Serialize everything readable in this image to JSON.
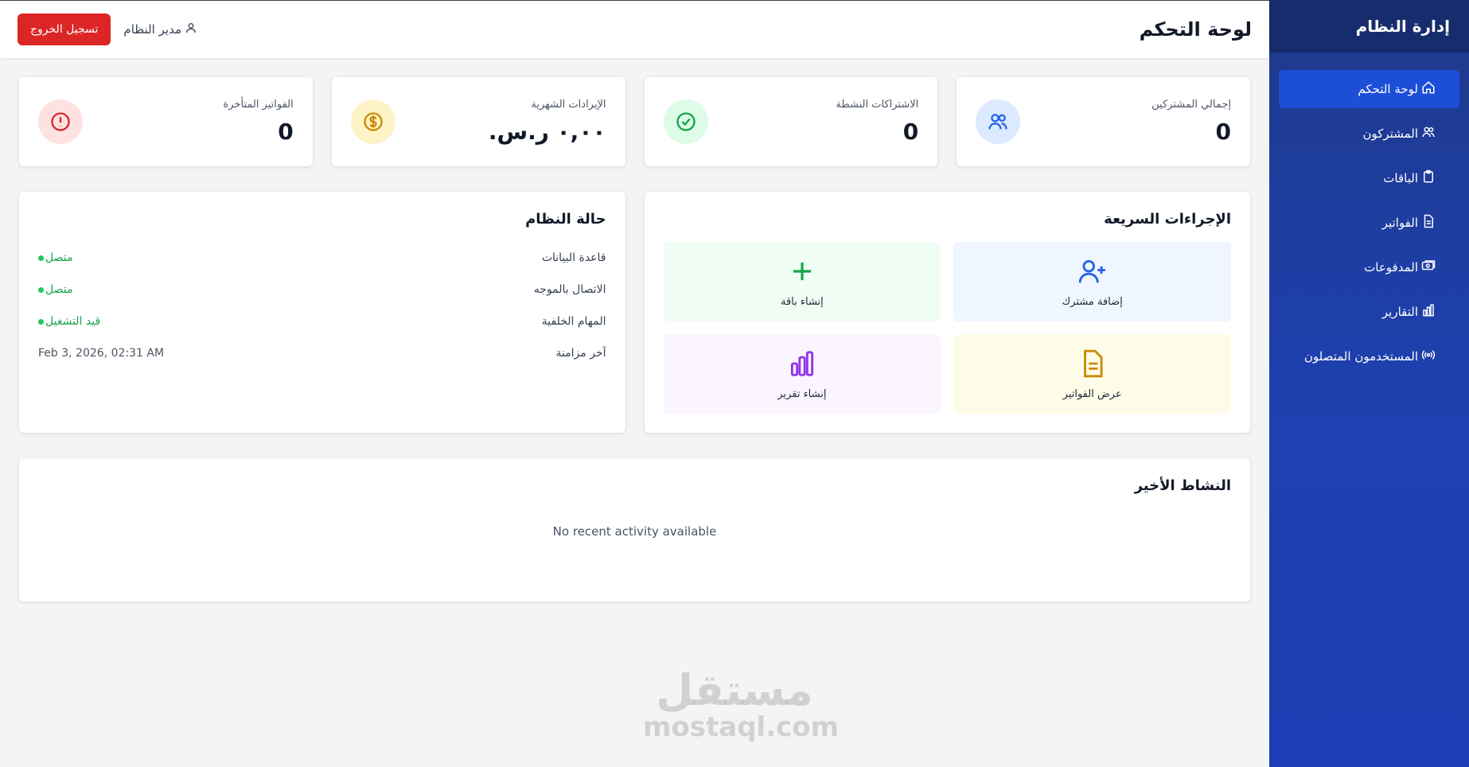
{
  "sidebar": {
    "title": "إدارة النظام",
    "items": [
      {
        "label": "لوحة التحكم",
        "icon": "home-icon",
        "active": true
      },
      {
        "label": "المشتركون",
        "icon": "users-icon"
      },
      {
        "label": "الباقات",
        "icon": "clipboard-icon"
      },
      {
        "label": "الفواتير",
        "icon": "document-icon"
      },
      {
        "label": "المدفوعات",
        "icon": "cash-icon"
      },
      {
        "label": "التقارير",
        "icon": "chart-icon"
      },
      {
        "label": "المستخدمون المتصلون",
        "icon": "broadcast-icon"
      }
    ]
  },
  "header": {
    "title": "لوحة التحكم",
    "user": "مدير النظام",
    "logout": "تسجيل الخروج"
  },
  "stats": [
    {
      "label": "إجمالي المشتركين",
      "value": "0",
      "icon": "users-icon",
      "color": "#2563eb",
      "bg": "#dbeafe"
    },
    {
      "label": "الاشتراكات النشطة",
      "value": "0",
      "icon": "check-circle-icon",
      "color": "#16a34a",
      "bg": "#dcfce7"
    },
    {
      "label": "الإيرادات الشهرية",
      "value": "٠,٠٠ ر.س.",
      "icon": "dollar-icon",
      "color": "#ca8a04",
      "bg": "#fef3c7"
    },
    {
      "label": "الفواتير المتأخرة",
      "value": "0",
      "icon": "alert-icon",
      "color": "#dc2626",
      "bg": "#fee2e2"
    }
  ],
  "quick_actions": {
    "title": "الإجراءات السريعة",
    "items": [
      {
        "label": "إضافة مشترك",
        "icon": "user-plus-icon",
        "color": "#2563eb",
        "bg": "#eff6ff"
      },
      {
        "label": "إنشاء باقة",
        "icon": "plus-icon",
        "color": "#16a34a",
        "bg": "#f0fdf4"
      },
      {
        "label": "عرض الفواتير",
        "icon": "document-icon",
        "color": "#ca8a04",
        "bg": "#fefce8"
      },
      {
        "label": "إنشاء تقرير",
        "icon": "chart-icon",
        "color": "#9333ea",
        "bg": "#faf5ff"
      }
    ]
  },
  "system_status": {
    "title": "حالة النظام",
    "rows": [
      {
        "key": "قاعدة البيانات",
        "value": "متصل"
      },
      {
        "key": "الاتصال بالموجه",
        "value": "متصل"
      },
      {
        "key": "المهام الخلفية",
        "value": "قيد التشغيل"
      },
      {
        "key": "آخر مزامنة",
        "value": "Feb 3, 2026, 02:31 AM"
      }
    ]
  },
  "activity": {
    "title": "النشاط الأخير",
    "empty": "No recent activity available"
  },
  "watermark": {
    "arabic": "مستقل",
    "latin": "mostaql.com"
  }
}
